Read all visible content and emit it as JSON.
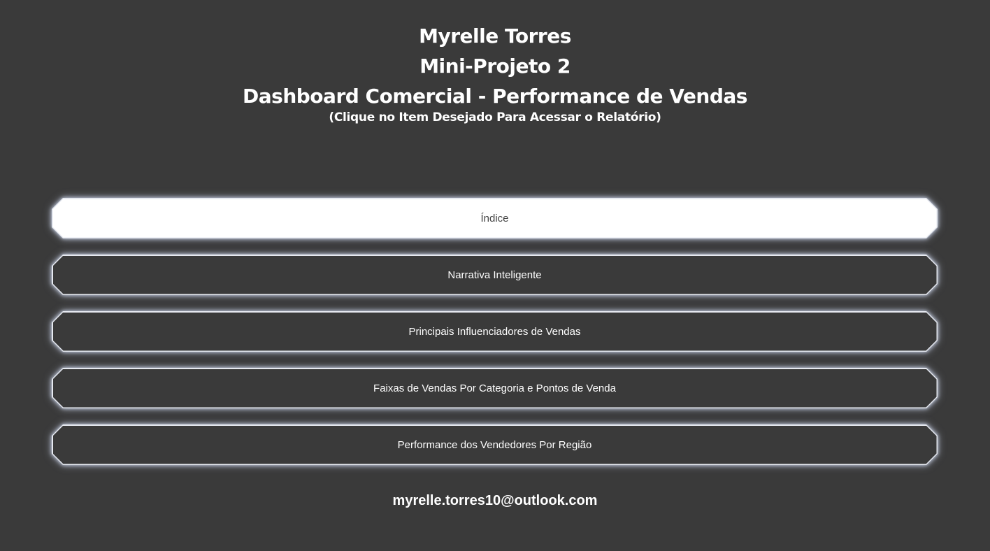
{
  "header": {
    "author": "Myrelle Torres",
    "project": "Mini-Projeto 2",
    "title": "Dashboard Comercial - Performance de Vendas",
    "instruction": "(Clique no Item Desejado Para Acessar o Relatório)"
  },
  "menu": {
    "selected_index": 0,
    "items": [
      {
        "label": "Índice"
      },
      {
        "label": "Narrativa Inteligente"
      },
      {
        "label": "Principais Influenciadores de Vendas"
      },
      {
        "label": "Faixas de Vendas Por Categoria e Pontos de Venda"
      },
      {
        "label": "Performance dos Vendedores Por Região"
      }
    ]
  },
  "footer": {
    "email": "myrelle.torres10@outlook.com"
  },
  "colors": {
    "background": "#3a3a3a",
    "button_border": "#e6e9f0",
    "button_glow": "#c9d2e6",
    "active_fill": "#ffffff",
    "active_text": "#444444",
    "text": "#ffffff"
  }
}
